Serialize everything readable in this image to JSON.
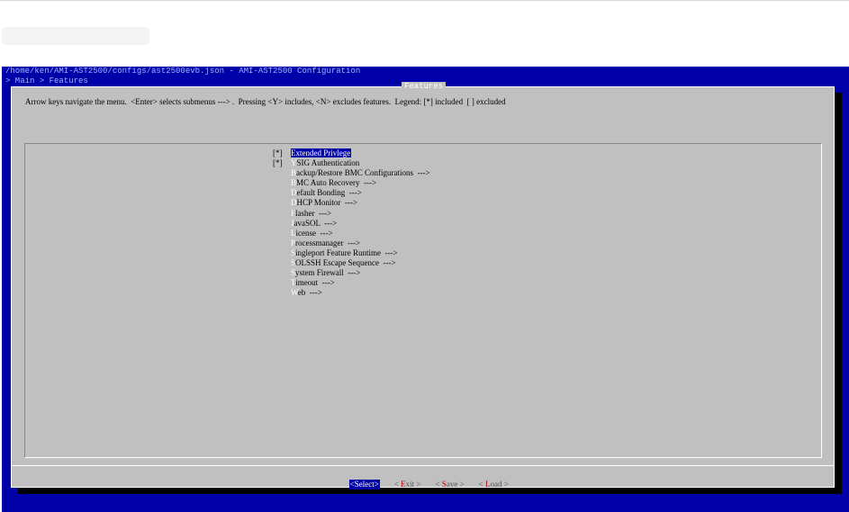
{
  "window": {
    "path_title": "/home/ken/AMI-AST2500/configs/ast2500evb.json - AMI-AST2500 Configuration",
    "breadcrumb": "> Main > Features"
  },
  "dialog": {
    "title": "Features",
    "instructions": "Arrow keys navigate the menu.  <Enter> selects submenus ---> .  Pressing <Y> includes, <N> excludes features.  Legend: [*] included  [ ] excluded"
  },
  "menu": {
    "items": [
      {
        "check": "[*]",
        "hotkey": "E",
        "rest": "xtended Privlege",
        "selected": true
      },
      {
        "check": "[*]",
        "hotkey": "Y",
        "rest": "SIG Authentication"
      },
      {
        "check": "",
        "hotkey": "B",
        "rest": "ackup/Restore BMC Configurations  --->"
      },
      {
        "check": "",
        "hotkey": "B",
        "rest": "MC Auto Recovery  --->"
      },
      {
        "check": "",
        "hotkey": "D",
        "rest": "efault Bonding  --->"
      },
      {
        "check": "",
        "hotkey": "D",
        "rest": "HCP Monitor  --->"
      },
      {
        "check": "",
        "hotkey": "F",
        "rest": "lasher  --->"
      },
      {
        "check": "",
        "hotkey": "J",
        "rest": "avaSOL  --->"
      },
      {
        "check": "",
        "hotkey": "L",
        "rest": "icense  --->"
      },
      {
        "check": "",
        "hotkey": "P",
        "rest": "rocessmanager  --->"
      },
      {
        "check": "",
        "hotkey": "S",
        "rest": "ingleport Feature Runtime  --->"
      },
      {
        "check": "",
        "hotkey": "S",
        "rest": "OLSSH Escape Sequence  --->"
      },
      {
        "check": "",
        "hotkey": "S",
        "rest": "ystem Firewall  --->"
      },
      {
        "check": "",
        "hotkey": "T",
        "rest": "imeout  --->"
      },
      {
        "check": "",
        "hotkey": "W",
        "rest": "eb  --->"
      }
    ]
  },
  "buttons": {
    "select": {
      "open": "<",
      "text": "Select",
      "close": ">"
    },
    "exit": {
      "open": "< ",
      "hotkey": "E",
      "rest": "xit",
      "close": " >"
    },
    "save": {
      "open": "< ",
      "hotkey": "S",
      "rest": "ave",
      "close": " >"
    },
    "load": {
      "open": "< ",
      "hotkey": "L",
      "rest": "oad",
      "close": " >"
    }
  },
  "colors": {
    "terminal_bg": "#0000a8",
    "dialog_bg": "#c0c0c0",
    "highlight": "#0000a8",
    "hotkey_red": "#b00000"
  }
}
